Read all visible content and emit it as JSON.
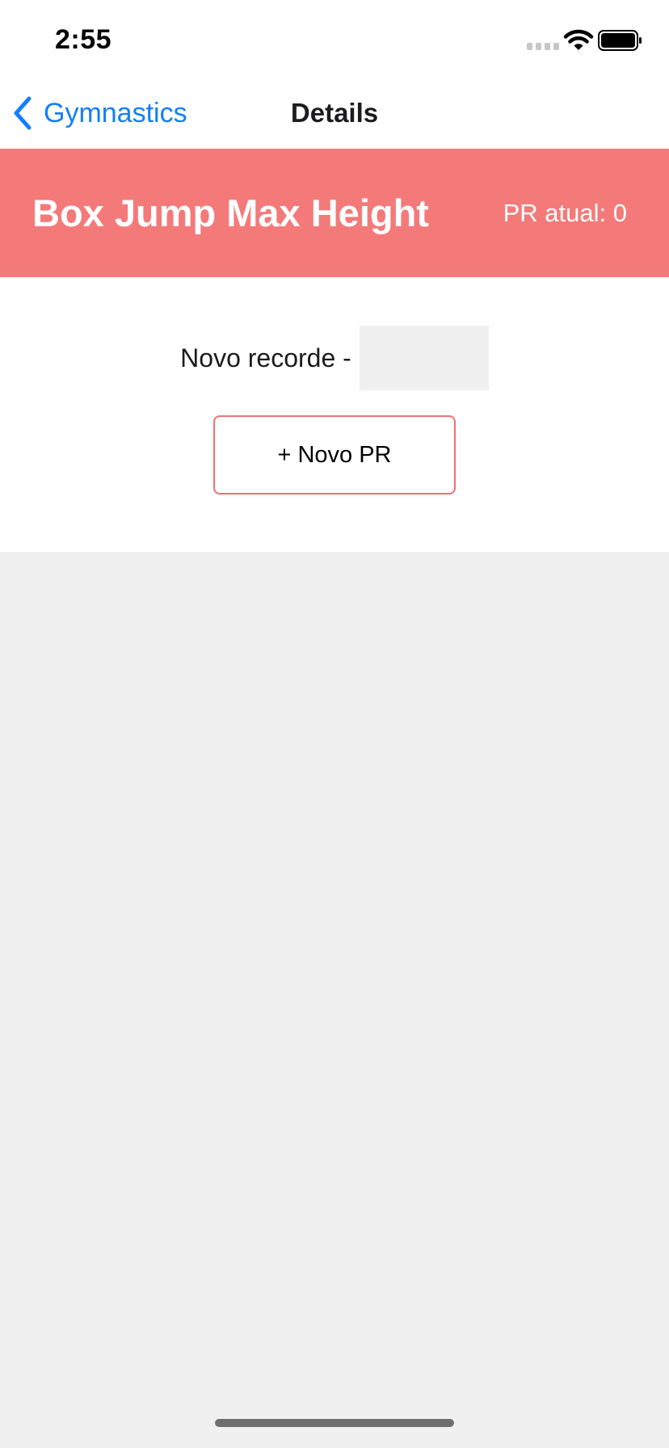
{
  "status_bar": {
    "time": "2:55",
    "icons": [
      "cellular-signal-icon",
      "wifi-icon",
      "battery-icon"
    ]
  },
  "nav": {
    "back_label": "Gymnastics",
    "back_icon": "chevron-left-icon",
    "title": "Details"
  },
  "banner": {
    "title": "Box Jump Max Height",
    "pr_text": "PR atual: 0"
  },
  "form": {
    "record_label": "Novo recorde -",
    "record_value": "",
    "add_button_label": "+ Novo PR"
  },
  "colors": {
    "accent_blue": "#147efb",
    "banner_red": "#f47a7a",
    "button_border": "#f07075",
    "background_gray": "#f0f0f0"
  }
}
